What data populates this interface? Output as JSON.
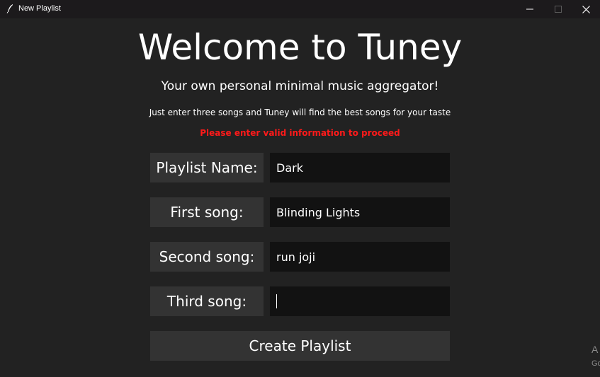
{
  "window": {
    "title": "New Playlist",
    "icon": "feather-icon",
    "controls": [
      "minimize-icon",
      "maximize-icon",
      "close-icon"
    ]
  },
  "header": {
    "title": "Welcome to Tuney",
    "subtitle": "Your own personal minimal music aggregator!",
    "instructions": "Just enter three songs and Tuney will find the best songs for your taste",
    "error": "Please enter valid information to proceed"
  },
  "form": {
    "playlist_name": {
      "label": "Playlist Name:",
      "value": "Dark"
    },
    "first_song": {
      "label": "First song:",
      "value": "Blinding Lights"
    },
    "second_song": {
      "label": "Second song:",
      "value": "run joji"
    },
    "third_song": {
      "label": "Third song:",
      "value": ""
    }
  },
  "actions": {
    "create_label": "Create Playlist"
  },
  "watermark": {
    "line1": "A",
    "line2": "Go"
  },
  "colors": {
    "background": "#222222",
    "titlebar": "#1c1a1c",
    "label_bg": "#333333",
    "input_bg": "#121212",
    "error": "#ff1a1a",
    "text": "#ffffff"
  }
}
